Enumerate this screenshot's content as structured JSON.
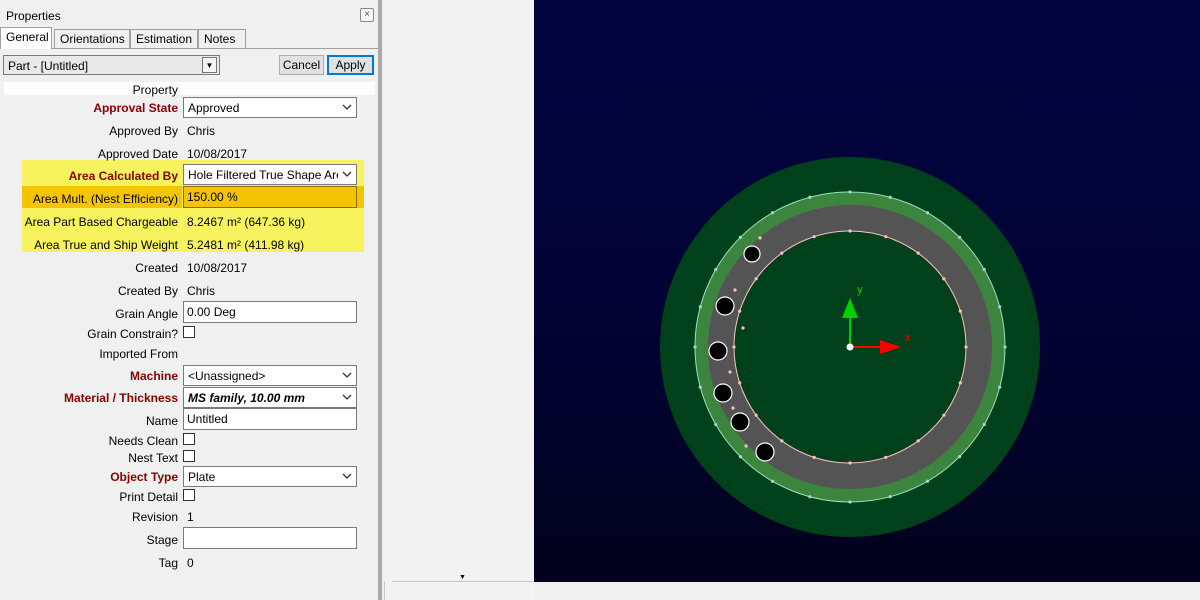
{
  "panel": {
    "title": "Properties",
    "close_icon": "close-icon",
    "tabs": [
      {
        "label": "General",
        "active": true
      },
      {
        "label": "Orientations",
        "active": false
      },
      {
        "label": "Estimation",
        "active": false
      },
      {
        "label": "Notes",
        "active": false
      }
    ],
    "part_selector": "Part - [Untitled]",
    "cancel_label": "Cancel",
    "apply_label": "Apply",
    "property_header": "Property"
  },
  "props": {
    "approval_state": {
      "label": "Approval State",
      "value": "Approved"
    },
    "approved_by": {
      "label": "Approved By",
      "value": "Chris"
    },
    "approved_date": {
      "label": "Approved Date",
      "value": "10/08/2017"
    },
    "area_calculated_by": {
      "label": "Area Calculated By",
      "value": "Hole Filtered True Shape Are"
    },
    "area_mult": {
      "label": "Area Mult. (Nest Efficiency)",
      "value": "150.00 %"
    },
    "area_part_based": {
      "label": "Area Part Based Chargeable",
      "value": "8.2467 m² (647.36 kg)"
    },
    "area_true_ship": {
      "label": "Area True and Ship Weight",
      "value": "5.2481 m² (411.98 kg)"
    },
    "created": {
      "label": "Created",
      "value": "10/08/2017"
    },
    "created_by": {
      "label": "Created By",
      "value": "Chris"
    },
    "grain_angle": {
      "label": "Grain Angle",
      "value": "0.00 Deg"
    },
    "grain_constrain": {
      "label": "Grain Constrain?",
      "checked": false
    },
    "imported_from": {
      "label": "Imported From",
      "value": ""
    },
    "machine": {
      "label": "Machine",
      "value": "<Unassigned>"
    },
    "material_thickness": {
      "label": "Material / Thickness",
      "value": "MS family, 10.00 mm"
    },
    "name": {
      "label": "Name",
      "value": "Untitled"
    },
    "needs_clean": {
      "label": "Needs Clean",
      "checked": false
    },
    "nest_text": {
      "label": "Nest Text",
      "checked": false
    },
    "object_type": {
      "label": "Object Type",
      "value": "Plate"
    },
    "print_detail": {
      "label": "Print Detail",
      "checked": false
    },
    "revision": {
      "label": "Revision",
      "value": "1"
    },
    "stage": {
      "label": "Stage",
      "value": ""
    },
    "tag": {
      "label": "Tag",
      "value": "0"
    }
  },
  "viewport": {
    "axis_x_label": "x",
    "axis_y_label": "y",
    "colors": {
      "outer_ring": "#00401b",
      "border_ring": "#3d843f",
      "part_body": "#545454",
      "outer_edge": "#8fe3c3",
      "inner_edge": "#ffc0c0",
      "x_axis": "#ff0000",
      "y_axis": "#00d000",
      "highlight_yellow": "#f7f35e",
      "highlight_orange": "#f5c400",
      "bold_label": "#8b0000",
      "apply_border": "#0078d7"
    }
  }
}
